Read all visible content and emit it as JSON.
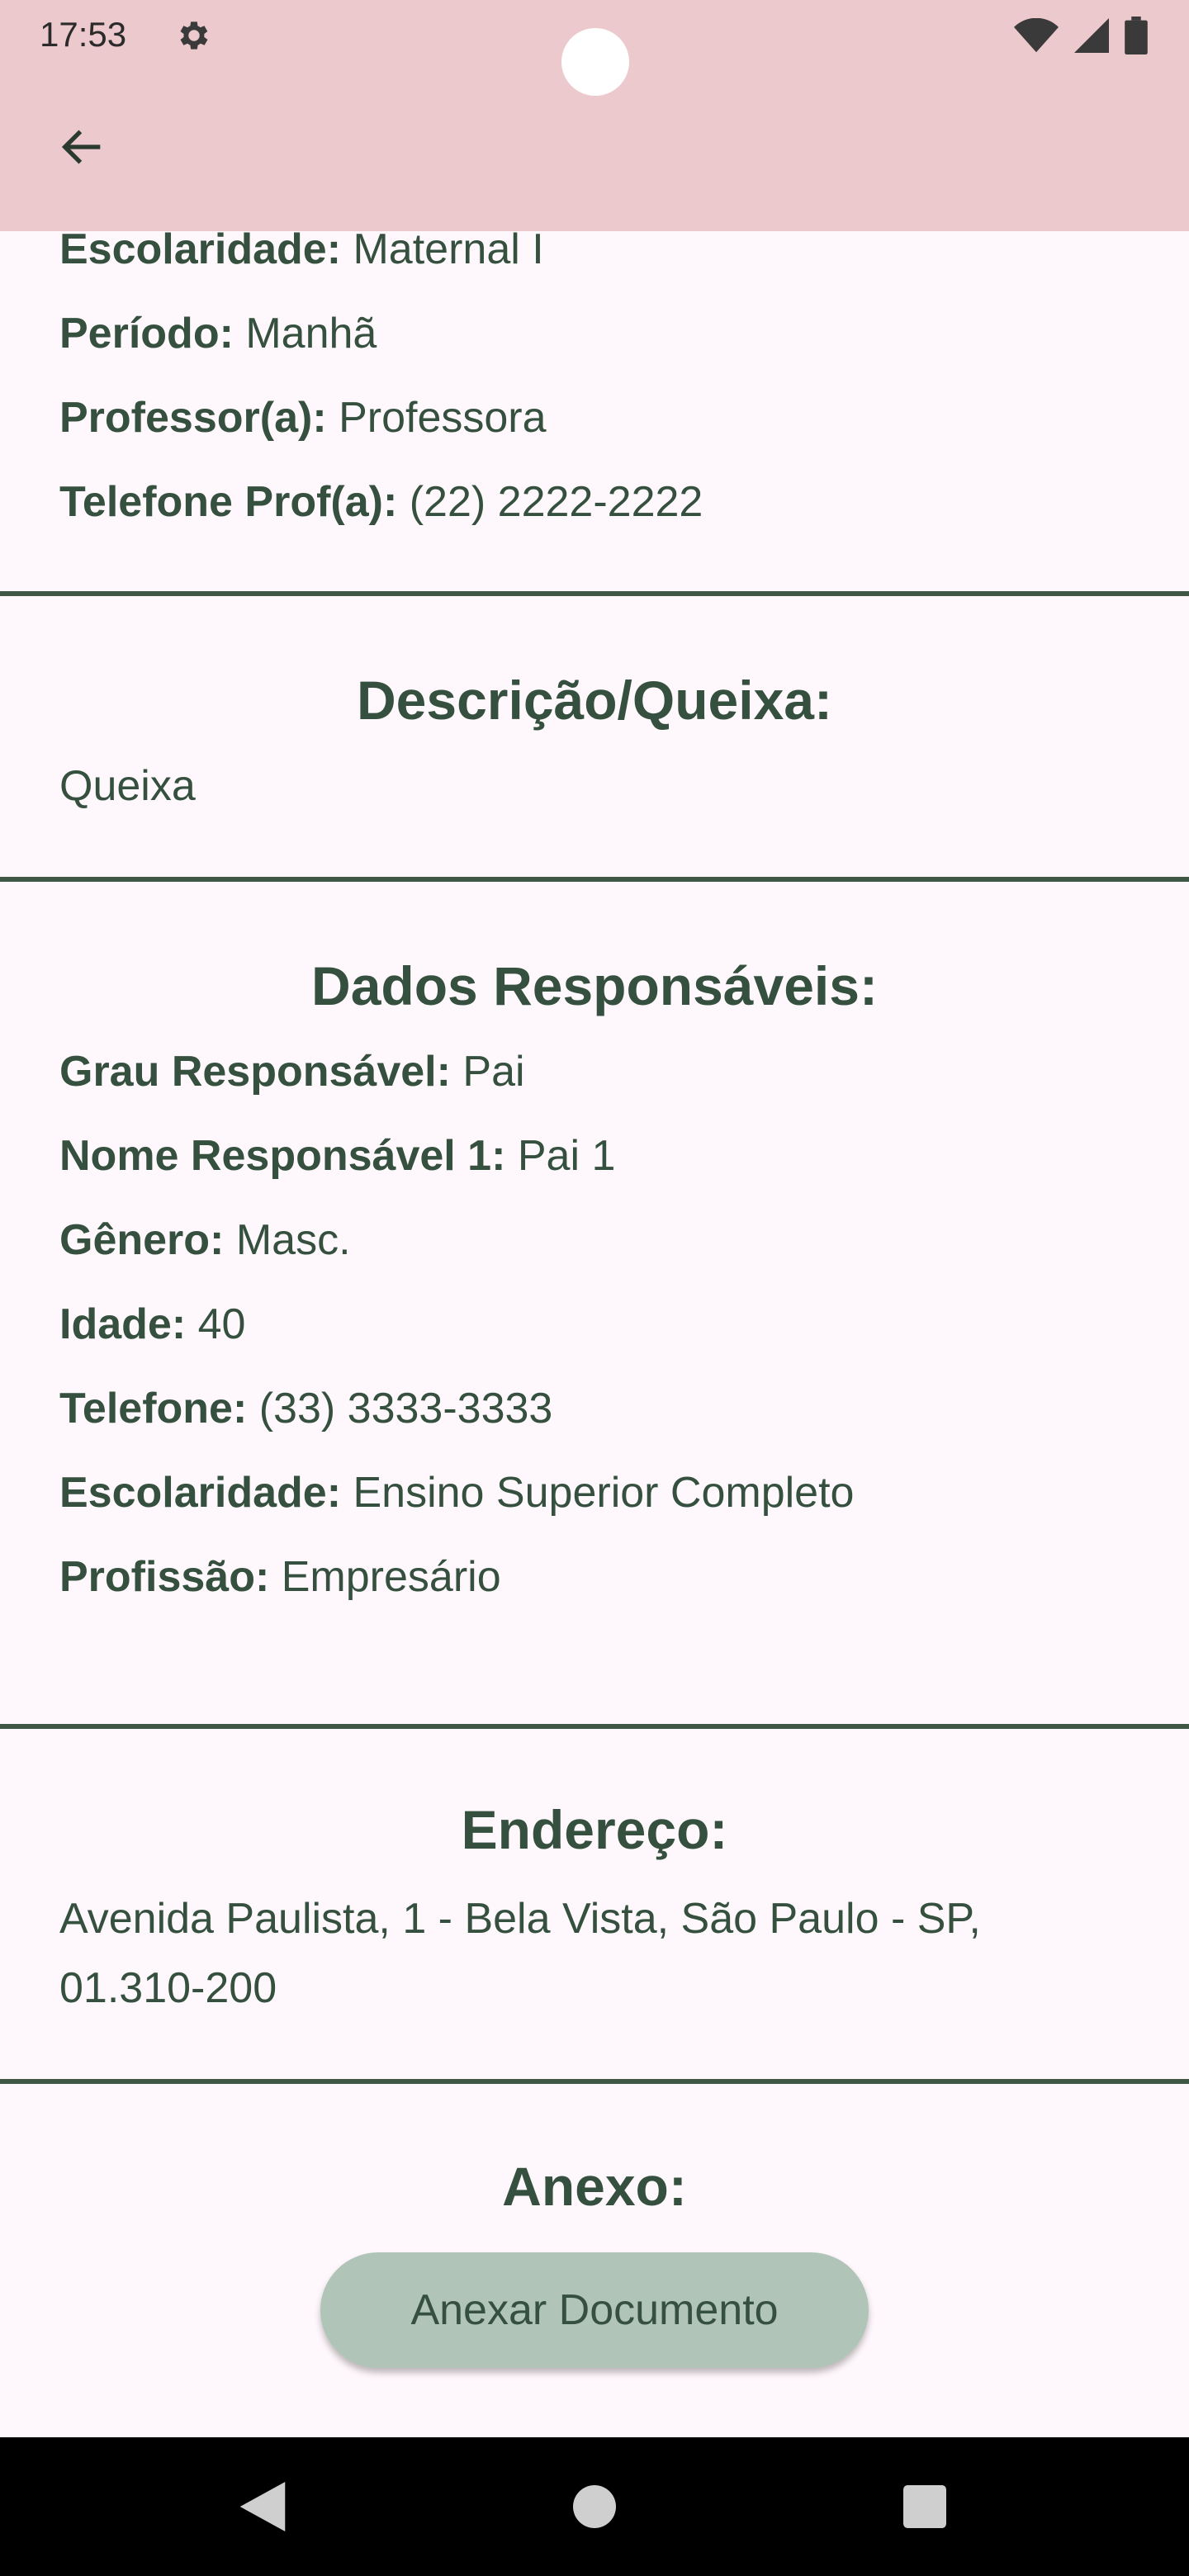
{
  "status_bar": {
    "time": "17:53"
  },
  "school": {
    "escolaridade": {
      "label": "Escolaridade:",
      "value": "Maternal I"
    },
    "periodo": {
      "label": "Período:",
      "value": "Manhã"
    },
    "professor": {
      "label": "Professor(a):",
      "value": "Professora"
    },
    "telefone_prof": {
      "label": "Telefone Prof(a):",
      "value": "(22) 2222-2222"
    }
  },
  "descricao": {
    "title": "Descrição/Queixa:",
    "text": "Queixa"
  },
  "responsaveis": {
    "title": "Dados Responsáveis:",
    "grau": {
      "label": "Grau Responsável:",
      "value": "Pai"
    },
    "nome": {
      "label": "Nome Responsável 1:",
      "value": "Pai 1"
    },
    "genero": {
      "label": "Gênero:",
      "value": "Masc."
    },
    "idade": {
      "label": "Idade:",
      "value": "40"
    },
    "telefone": {
      "label": "Telefone:",
      "value": "(33) 3333-3333"
    },
    "escolaridade": {
      "label": "Escolaridade:",
      "value": "Ensino Superior Completo"
    },
    "profissao": {
      "label": "Profissão:",
      "value": "Empresário"
    }
  },
  "endereco": {
    "title": "Endereço:",
    "line1": "Avenida Paulista, 1 - Bela Vista, São Paulo - SP,",
    "line2": "01.310-200"
  },
  "anexo": {
    "title": "Anexo:",
    "button_label": "Anexar Documento"
  },
  "colors": {
    "header": "#ecc9cc",
    "text": "#35503e",
    "button": "#b0c4b8",
    "background": "#fef7fb"
  }
}
